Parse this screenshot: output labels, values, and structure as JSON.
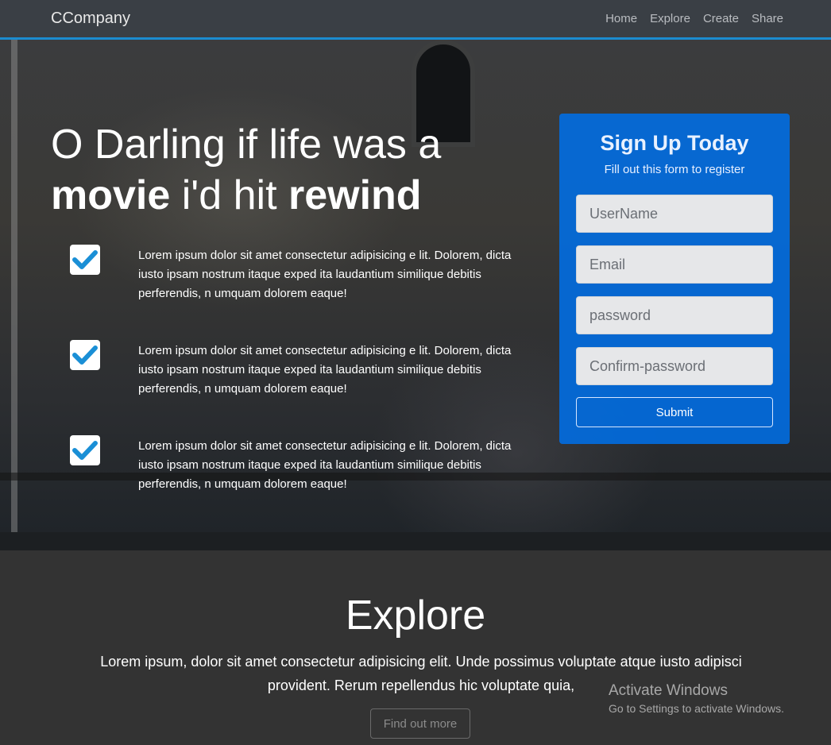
{
  "navbar": {
    "brand": "CCompany",
    "links": [
      "Home",
      "Explore",
      "Create",
      "Share"
    ]
  },
  "hero": {
    "headline_line1": "O Darling if life was a",
    "headline_bold1": "movie",
    "headline_mid": " i'd hit ",
    "headline_bold2": "rewind",
    "features": [
      "Lorem ipsum dolor sit amet consectetur adipisicing e lit. Dolorem, dicta iusto ipsam nostrum itaque exped ita laudantium similique debitis perferendis, n umquam dolorem eaque!",
      "Lorem ipsum dolor sit amet consectetur adipisicing e lit. Dolorem, dicta iusto ipsam nostrum itaque exped ita laudantium similique debitis perferendis, n umquam dolorem eaque!",
      "Lorem ipsum dolor sit amet consectetur adipisicing e lit. Dolorem, dicta iusto ipsam nostrum itaque exped ita laudantium similique debitis perferendis, n umquam dolorem eaque!"
    ]
  },
  "signup": {
    "title": "Sign Up Today",
    "subtitle": "Fill out this form to register",
    "username_placeholder": "UserName",
    "email_placeholder": "Email",
    "password_placeholder": "password",
    "confirm_placeholder": "Confirm-password",
    "submit_label": "Submit"
  },
  "explore": {
    "title": "Explore",
    "body": "Lorem ipsum, dolor sit amet consectetur adipisicing elit. Unde possimus voluptate atque iusto adipisci provident. Rerum repellendus hic voluptate quia,",
    "button_label": "Find out more"
  },
  "watermark": {
    "line1": "Activate Windows",
    "line2": "Go to Settings to activate Windows."
  },
  "colors": {
    "accent": "#1b8cd0",
    "signup_bg": "#006ee6",
    "check_color": "#1a8fd6"
  },
  "icons": {
    "feature_check": "checkbox-check-icon"
  }
}
